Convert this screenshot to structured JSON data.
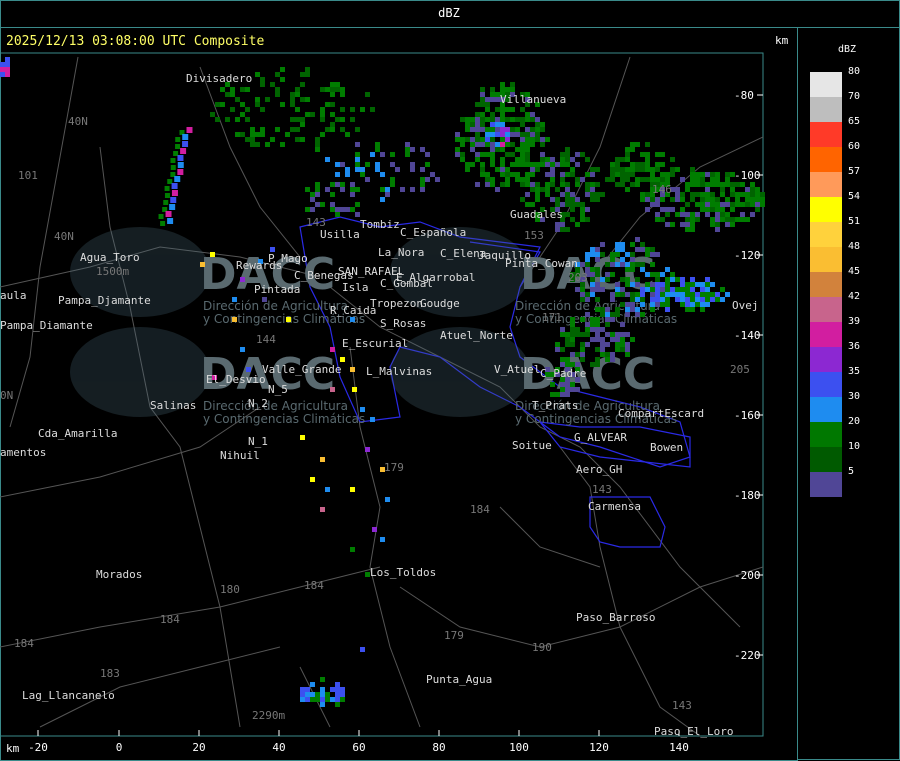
{
  "header": {
    "title": "dBZ"
  },
  "map": {
    "timestamp": "2025/12/13 03:08:00 UTC Composite",
    "km_top": "km",
    "km_bottom": "km",
    "y_axis": [
      "-80",
      "-100",
      "-120",
      "-140",
      "-160",
      "-180",
      "-200",
      "-220"
    ],
    "x_axis": [
      "-20",
      "0",
      "20",
      "40",
      "60",
      "80",
      "100",
      "120",
      "140"
    ],
    "places": [
      {
        "name": "Divisadero"
      },
      {
        "name": "Villanueva"
      },
      {
        "name": "Guadales"
      },
      {
        "name": "Agua_Toro"
      },
      {
        "name": "Usilla"
      },
      {
        "name": "Tombiz"
      },
      {
        "name": "C_Española"
      },
      {
        "name": "C_Elena"
      },
      {
        "name": "Jaquillo"
      },
      {
        "name": "P_Mago"
      },
      {
        "name": "Rewards"
      },
      {
        "name": "La_Nora"
      },
      {
        "name": "C_Benegas"
      },
      {
        "name": "SAN_RAFAEL"
      },
      {
        "name": "E_Algarrobal"
      },
      {
        "name": "Pinta_Cowan"
      },
      {
        "name": "C_Gombal"
      },
      {
        "name": "Pintada"
      },
      {
        "name": "Isla"
      },
      {
        "name": "Pampa_Diamante"
      },
      {
        "name": "Tropezon"
      },
      {
        "name": "Goudge"
      },
      {
        "name": "R_Caida"
      },
      {
        "name": "S_Rosas"
      },
      {
        "name": "Atuel_Norte"
      },
      {
        "name": "E_Escurial"
      },
      {
        "name": "V_Atuel"
      },
      {
        "name": "C_Padre"
      },
      {
        "name": "Valle_Grande"
      },
      {
        "name": "L_Malvinas"
      },
      {
        "name": "El_Desvio"
      },
      {
        "name": "N_5"
      },
      {
        "name": "N_2"
      },
      {
        "name": "Salinas"
      },
      {
        "name": "T_Prats"
      },
      {
        "name": "CompartEscard"
      },
      {
        "name": "Cda_Amarilla"
      },
      {
        "name": "N_1"
      },
      {
        "name": "G_ALVEAR"
      },
      {
        "name": "Soitue"
      },
      {
        "name": "Bowen"
      },
      {
        "name": "amentos"
      },
      {
        "name": "Nihuil"
      },
      {
        "name": "Aero_GH"
      },
      {
        "name": "Carmensa"
      },
      {
        "name": "Morados"
      },
      {
        "name": "Los_Toldos"
      },
      {
        "name": "Paso_Barroso"
      },
      {
        "name": "Punta_Agua"
      },
      {
        "name": "Lag_Llancanelo"
      },
      {
        "name": "Paso_El_Loro"
      },
      {
        "name": "aula"
      },
      {
        "name": "Ovej"
      },
      {
        "name": "Pampa_Djamante"
      }
    ],
    "route_numbers": [
      "40N",
      "40N",
      "101",
      "143",
      "153",
      "203",
      "171",
      "144",
      "179",
      "184",
      "180",
      "184",
      "184",
      "183",
      "179",
      "190",
      "143",
      "143",
      "146",
      "205",
      "184",
      "0N"
    ],
    "elevations": [
      "1500m",
      "2290m"
    ],
    "watermark": {
      "logo": "DACC",
      "line1": "Dirección de Agricultura",
      "line2": "y Contingencias Climáticas"
    }
  },
  "legend": {
    "title": "dBZ",
    "items": [
      {
        "label": "80",
        "color": "#e6e6e6"
      },
      {
        "label": "70",
        "color": "#bebebe"
      },
      {
        "label": "65",
        "color": "#ff3a28"
      },
      {
        "label": "60",
        "color": "#ff6400"
      },
      {
        "label": "57",
        "color": "#ff9a5a"
      },
      {
        "label": "54",
        "color": "#ffff00"
      },
      {
        "label": "51",
        "color": "#ffd23c"
      },
      {
        "label": "48",
        "color": "#fabe32"
      },
      {
        "label": "45",
        "color": "#d2823c"
      },
      {
        "label": "42",
        "color": "#c8648c"
      },
      {
        "label": "39",
        "color": "#d21ea0"
      },
      {
        "label": "36",
        "color": "#8c28d2"
      },
      {
        "label": "35",
        "color": "#3c50f0"
      },
      {
        "label": "30",
        "color": "#1e8cf0"
      },
      {
        "label": "20",
        "color": "#007800"
      },
      {
        "label": "10",
        "color": "#005a00"
      },
      {
        "label": "5",
        "color": "#504696"
      }
    ]
  }
}
